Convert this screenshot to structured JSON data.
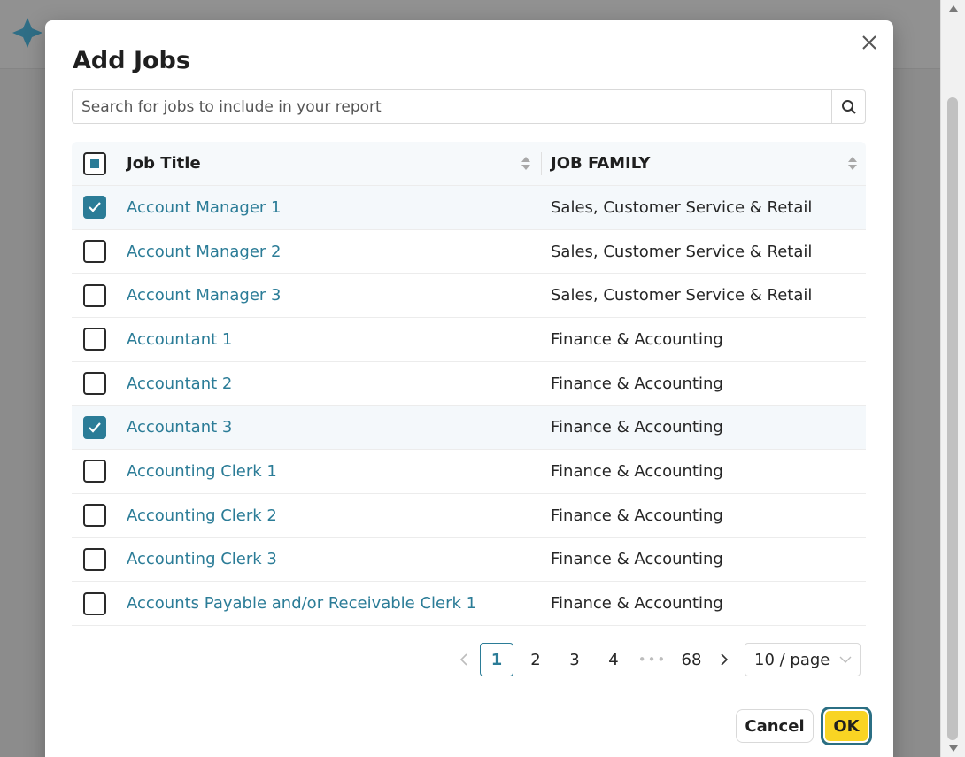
{
  "modal": {
    "title": "Add Jobs",
    "search_placeholder": "Search for jobs to include in your report"
  },
  "table": {
    "columns": [
      "Job Title",
      "JOB FAMILY"
    ],
    "rows": [
      {
        "title": "Account Manager 1",
        "family": "Sales, Customer Service & Retail",
        "checked": true
      },
      {
        "title": "Account Manager 2",
        "family": "Sales, Customer Service & Retail",
        "checked": false
      },
      {
        "title": "Account Manager 3",
        "family": "Sales, Customer Service & Retail",
        "checked": false
      },
      {
        "title": "Accountant 1",
        "family": "Finance & Accounting",
        "checked": false
      },
      {
        "title": "Accountant 2",
        "family": "Finance & Accounting",
        "checked": false
      },
      {
        "title": "Accountant 3",
        "family": "Finance & Accounting",
        "checked": true
      },
      {
        "title": "Accounting Clerk 1",
        "family": "Finance & Accounting",
        "checked": false
      },
      {
        "title": "Accounting Clerk 2",
        "family": "Finance & Accounting",
        "checked": false
      },
      {
        "title": "Accounting Clerk 3",
        "family": "Finance & Accounting",
        "checked": false
      },
      {
        "title": "Accounts Payable and/or Receivable Clerk 1",
        "family": "Finance & Accounting",
        "checked": false
      }
    ]
  },
  "pagination": {
    "pages": [
      "1",
      "2",
      "3",
      "4"
    ],
    "active": "1",
    "ellipsis": "•••",
    "last_page": "68",
    "page_size": "10 / page"
  },
  "footer": {
    "cancel_label": "Cancel",
    "ok_label": "OK"
  },
  "colors": {
    "accent": "#2b7c97",
    "ok_button": "#f9d423",
    "ok_border": "#2b6f84"
  },
  "icons": {
    "close": "close-icon",
    "search": "search-icon",
    "sort": "sort-icon",
    "prev": "chevron-left-icon",
    "next": "chevron-right-icon",
    "dropdown": "chevron-down-icon"
  }
}
